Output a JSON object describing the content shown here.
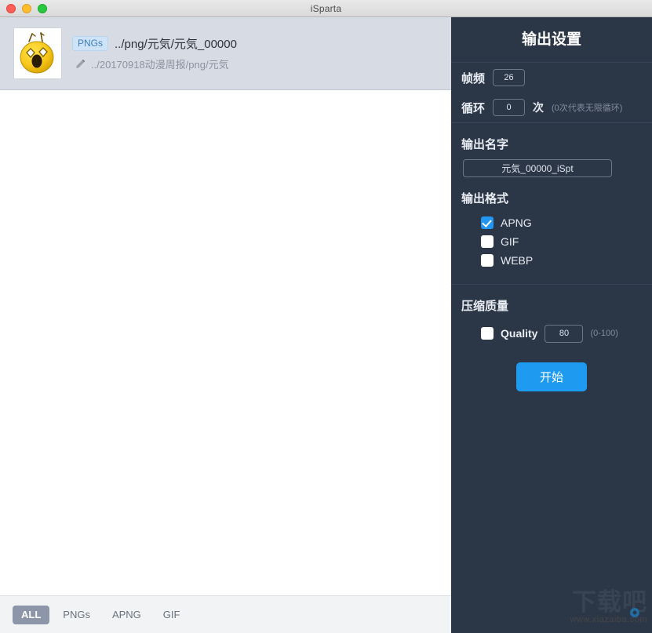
{
  "window": {
    "title": "iSparta",
    "controls": [
      "close",
      "minimize",
      "zoom"
    ]
  },
  "file_list": {
    "items": [
      {
        "badge": "PNGs",
        "path": "../png/元気/元気_00000",
        "subpath": "../20170918动漫周报/png/元気",
        "thumb_alt": "surprised-face-emoji"
      }
    ]
  },
  "bottom_filters": {
    "tabs": [
      {
        "label": "ALL",
        "active": true
      },
      {
        "label": "PNGs",
        "active": false
      },
      {
        "label": "APNG",
        "active": false
      },
      {
        "label": "GIF",
        "active": false
      }
    ]
  },
  "settings": {
    "title": "输出设置",
    "frame_rate": {
      "label": "帧频",
      "value": "26"
    },
    "loop": {
      "label": "循环",
      "value": "0",
      "unit": "次",
      "hint": "(0次代表无限循环)"
    },
    "output_name": {
      "title": "输出名字",
      "value": "元気_00000_iSpt"
    },
    "output_format": {
      "title": "输出格式",
      "options": [
        {
          "label": "APNG",
          "checked": true
        },
        {
          "label": "GIF",
          "checked": false
        },
        {
          "label": "WEBP",
          "checked": false
        }
      ]
    },
    "compression": {
      "title": "压缩质量",
      "checkbox_label": "Quality",
      "checked": false,
      "value": "80",
      "range_hint": "(0-100)"
    },
    "start_button": "开始"
  },
  "watermark": {
    "main": "下载吧",
    "sub": "www.xiazaiba.com"
  },
  "colors": {
    "panel_bg": "#2b3646",
    "accent_blue": "#1e9bf0",
    "checkbox_blue": "#2196f3",
    "row_bg": "#d7dce4",
    "bottombar_bg": "#f2f3f5",
    "active_tab_bg": "#8c96a8"
  }
}
